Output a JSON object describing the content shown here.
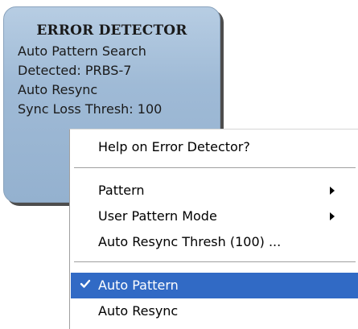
{
  "panel": {
    "title": "ERROR DETECTOR",
    "lines": [
      "Auto Pattern Search",
      "Detected: PRBS-7",
      "Auto Resync",
      "Sync Loss Thresh: 100"
    ]
  },
  "context_menu": {
    "items": [
      {
        "label": "Help on Error Detector?",
        "submenu": false,
        "checked": false,
        "highlighted": false
      },
      {
        "label": "Pattern",
        "submenu": true,
        "checked": false,
        "highlighted": false
      },
      {
        "label": "User Pattern Mode",
        "submenu": true,
        "checked": false,
        "highlighted": false
      },
      {
        "label": "Auto Resync Thresh (100) ...",
        "submenu": false,
        "checked": false,
        "highlighted": false
      },
      {
        "label": "Auto Pattern",
        "submenu": false,
        "checked": true,
        "highlighted": true
      },
      {
        "label": "Auto Resync",
        "submenu": false,
        "checked": false,
        "highlighted": false
      }
    ]
  },
  "colors": {
    "panel_fill": "#9fbad6",
    "highlight": "#316ac5"
  }
}
